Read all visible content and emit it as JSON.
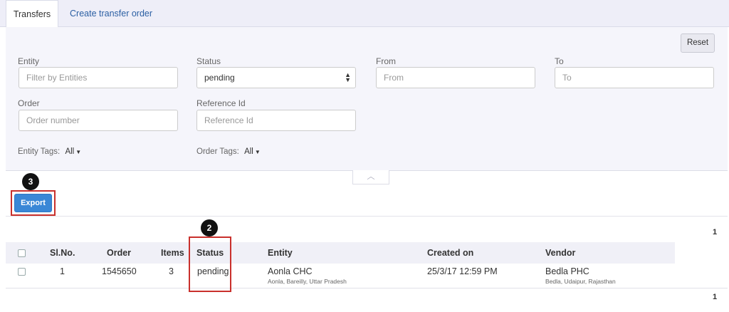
{
  "tabs": [
    {
      "label": "Transfers"
    },
    {
      "label": "Create transfer order"
    }
  ],
  "filters": {
    "reset_label": "Reset",
    "entity": {
      "label": "Entity",
      "placeholder": "Filter by Entities"
    },
    "status": {
      "label": "Status",
      "value": "pending"
    },
    "from": {
      "label": "From",
      "placeholder": "From"
    },
    "to": {
      "label": "To",
      "placeholder": "To"
    },
    "order": {
      "label": "Order",
      "placeholder": "Order number"
    },
    "reference": {
      "label": "Reference Id",
      "placeholder": "Reference Id"
    },
    "entity_tags": {
      "label": "Entity Tags:",
      "value": "All"
    },
    "order_tags": {
      "label": "Order Tags:",
      "value": "All"
    }
  },
  "export_label": "Export",
  "callouts": {
    "export": "3",
    "status": "2"
  },
  "pager_top": "1",
  "pager_bottom": "1",
  "table": {
    "headers": [
      "Sl.No.",
      "Order",
      "Items",
      "Status",
      "Entity",
      "Created on",
      "Vendor"
    ],
    "rows": [
      {
        "slno": "1",
        "order": "1545650",
        "items": "3",
        "status": "pending",
        "entity": "Aonla CHC",
        "entity_location": "Aonla, Bareilly, Uttar Pradesh",
        "created_on": "25/3/17 12:59 PM",
        "vendor": "Bedla PHC",
        "vendor_location": "Bedla, Udaipur, Rajasthan"
      }
    ]
  },
  "colors": {
    "primary": "#3a87d6",
    "callout": "#c9302c",
    "link": "#2b5fa3"
  }
}
